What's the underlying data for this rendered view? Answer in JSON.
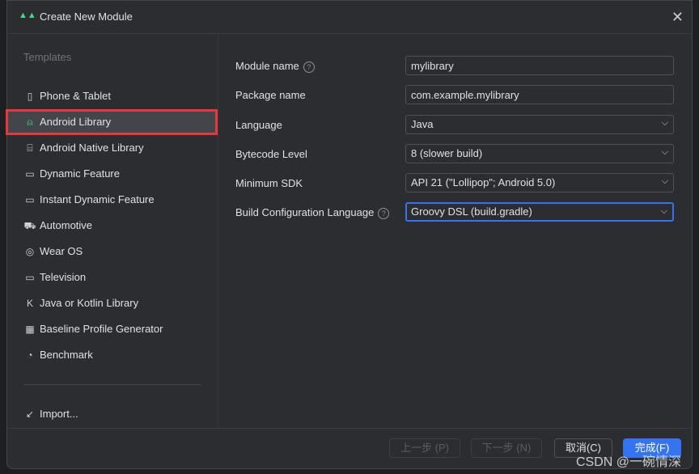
{
  "window": {
    "title": "Create New Module",
    "close": "✕"
  },
  "sidebar": {
    "heading": "Templates",
    "items": [
      {
        "label": "Phone & Tablet",
        "icon": "phone-tablet-icon",
        "glyph": "▯"
      },
      {
        "label": "Android Library",
        "icon": "android-icon",
        "glyph": "⍝",
        "selected": true
      },
      {
        "label": "Android Native Library",
        "icon": "chip-icon",
        "glyph": "⌸"
      },
      {
        "label": "Dynamic Feature",
        "icon": "folder-feature-icon",
        "glyph": "▭"
      },
      {
        "label": "Instant Dynamic Feature",
        "icon": "folder-instant-icon",
        "glyph": "▭"
      },
      {
        "label": "Automotive",
        "icon": "car-icon",
        "glyph": "⛟"
      },
      {
        "label": "Wear OS",
        "icon": "watch-icon",
        "glyph": "◎"
      },
      {
        "label": "Television",
        "icon": "tv-icon",
        "glyph": "▭"
      },
      {
        "label": "Java or Kotlin Library",
        "icon": "kotlin-icon",
        "glyph": "K"
      },
      {
        "label": "Baseline Profile Generator",
        "icon": "baseline-icon",
        "glyph": "▦"
      },
      {
        "label": "Benchmark",
        "icon": "gauge-icon",
        "glyph": "◔"
      }
    ],
    "import": {
      "label": "Import...",
      "glyph": "↙"
    }
  },
  "form": {
    "module_name": {
      "label": "Module name",
      "value": "mylibrary"
    },
    "package_name": {
      "label": "Package name",
      "value": "com.example.mylibrary"
    },
    "language": {
      "label": "Language",
      "value": "Java"
    },
    "bytecode": {
      "label": "Bytecode Level",
      "value": "8 (slower build)"
    },
    "min_sdk": {
      "label": "Minimum SDK",
      "value": "API 21 (\"Lollipop\"; Android 5.0)"
    },
    "build_lang": {
      "label": "Build Configuration Language",
      "value": "Groovy DSL (build.gradle)"
    }
  },
  "buttons": {
    "prev": "上一步 (P)",
    "next": "下一步 (N)",
    "cancel": "取消(C)",
    "finish": "完成(F)"
  },
  "watermark": "CSDN @一碗情深",
  "colors": {
    "accent": "#3574f0",
    "android": "#3ddc84",
    "highlight": "#e8363a"
  }
}
